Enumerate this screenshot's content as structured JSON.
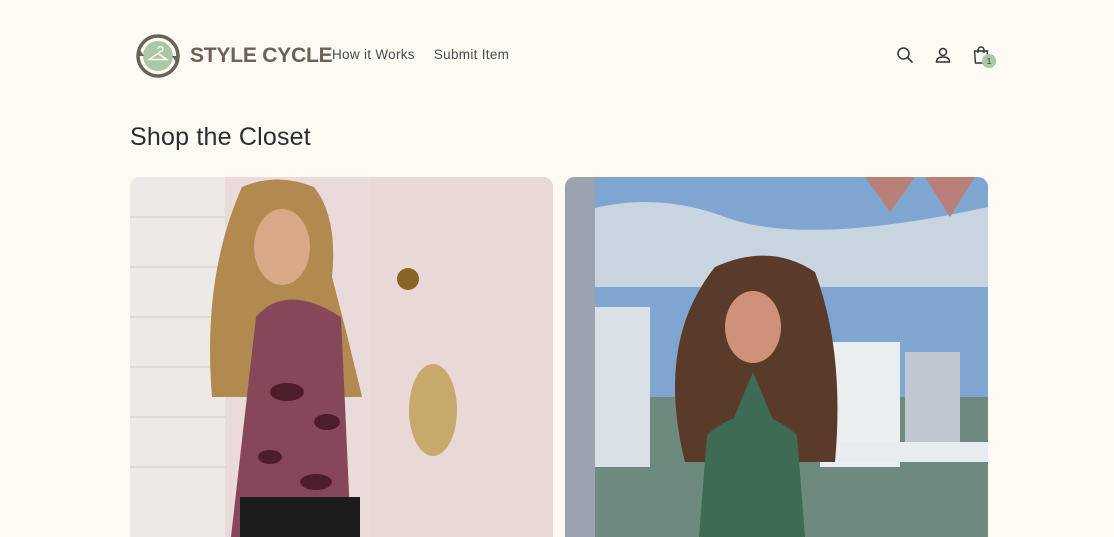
{
  "brand": {
    "name": "STYLE CYCLE",
    "logo_icon": "hanger-cycle-icon"
  },
  "nav": {
    "items": [
      {
        "label": "How it Works"
      },
      {
        "label": "Submit Item"
      }
    ]
  },
  "header_icons": {
    "search": "search-icon",
    "account": "user-icon",
    "cart": "shopping-bag-icon",
    "cart_count": "1"
  },
  "page": {
    "title": "Shop the Closet"
  },
  "products": [
    {
      "image": "product-photo-floral-top"
    },
    {
      "image": "product-photo-green-halter"
    }
  ],
  "colors": {
    "background": "#fdf9f3",
    "accent": "#a9c8a5",
    "brand_text": "#6b6156"
  }
}
